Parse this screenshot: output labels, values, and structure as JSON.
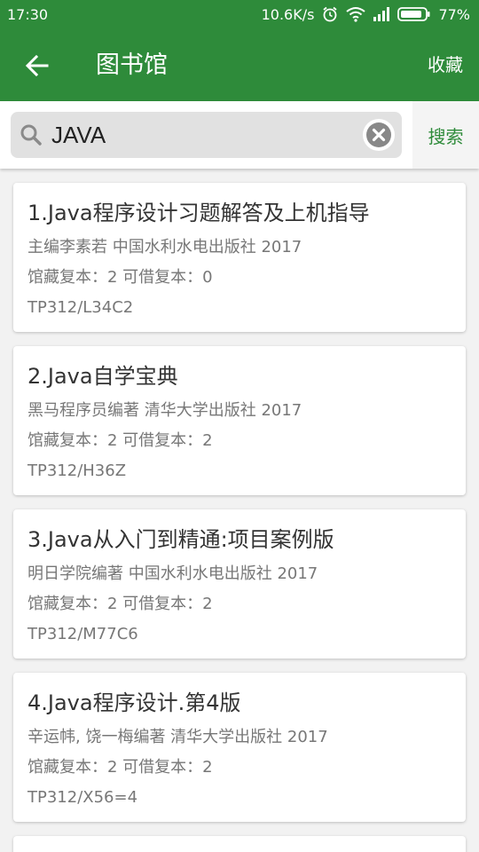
{
  "status_bar": {
    "time": "17:30",
    "net_speed": "10.6K/s",
    "battery": "77%",
    "icons": [
      "alarm-icon",
      "wifi-icon",
      "signal-icon",
      "battery-icon"
    ]
  },
  "toolbar": {
    "back_icon": "back-arrow-icon",
    "title": "图书馆",
    "favorite_label": "收藏"
  },
  "search": {
    "value": "JAVA",
    "search_icon": "search-icon",
    "clear_icon": "clear-icon",
    "button_label": "搜索"
  },
  "results": [
    {
      "title": "1.Java程序设计习题解答及上机指导",
      "author_publisher": "主编李素若 中国水利水电出版社 2017",
      "copies": "馆藏复本：2 可借复本：0",
      "call_number": "TP312/L34C2"
    },
    {
      "title": "2.Java自学宝典",
      "author_publisher": "黑马程序员编著 清华大学出版社 2017",
      "copies": "馆藏复本：2 可借复本：2",
      "call_number": "TP312/H36Z"
    },
    {
      "title": "3.Java从入门到精通:项目案例版",
      "author_publisher": "明日学院编著 中国水利水电出版社 2017",
      "copies": "馆藏复本：2 可借复本：2",
      "call_number": "TP312/M77C6"
    },
    {
      "title": "4.Java程序设计.第4版",
      "author_publisher": "辛运帏, 饶一梅编著 清华大学出版社 2017",
      "copies": "馆藏复本：2 可借复本：2",
      "call_number": "TP312/X56=4"
    }
  ],
  "colors": {
    "primary": "#2e8b3a",
    "background": "#f2f2f2",
    "card": "#ffffff"
  }
}
